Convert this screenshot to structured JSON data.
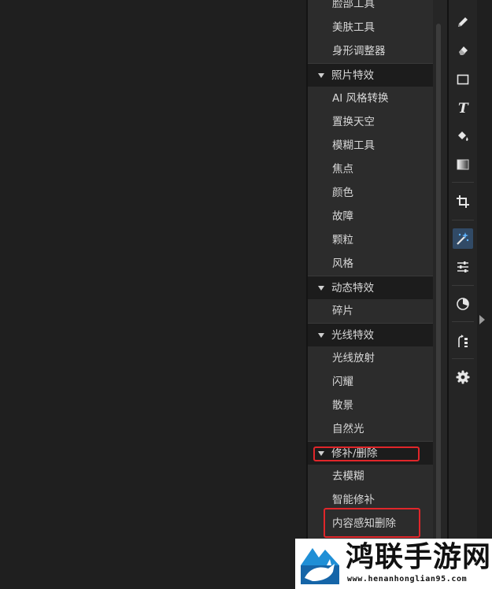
{
  "panel": {
    "rows": [
      {
        "type": "item",
        "label": "脸部工具"
      },
      {
        "type": "item",
        "label": "美肤工具"
      },
      {
        "type": "item",
        "label": "身形调整器"
      },
      {
        "type": "header",
        "label": "照片特效"
      },
      {
        "type": "item",
        "label": "AI 风格转换"
      },
      {
        "type": "item",
        "label": "置换天空"
      },
      {
        "type": "item",
        "label": "模糊工具"
      },
      {
        "type": "item",
        "label": "焦点"
      },
      {
        "type": "item",
        "label": "颜色"
      },
      {
        "type": "item",
        "label": "故障"
      },
      {
        "type": "item",
        "label": "颗粒"
      },
      {
        "type": "item",
        "label": "风格"
      },
      {
        "type": "header",
        "label": "动态特效"
      },
      {
        "type": "item",
        "label": "碎片"
      },
      {
        "type": "header",
        "label": "光线特效"
      },
      {
        "type": "item",
        "label": "光线放射"
      },
      {
        "type": "item",
        "label": "闪耀"
      },
      {
        "type": "item",
        "label": "散景"
      },
      {
        "type": "item",
        "label": "自然光"
      },
      {
        "type": "header",
        "label": "修补/删除"
      },
      {
        "type": "item",
        "label": "去模糊"
      },
      {
        "type": "item",
        "label": "智能修补"
      },
      {
        "type": "item",
        "label": "内容感知删除"
      }
    ]
  },
  "toolbar": {
    "tools": [
      "brush-icon",
      "eraser-icon",
      "rectangle-icon",
      "text-icon",
      "fill-icon",
      "gradient-icon",
      "crop-icon",
      "magic-wand-icon",
      "adjust-sliders-icon",
      "mask-icon",
      "effects-icon",
      "settings-icon"
    ],
    "active_tool": "magic-wand-icon"
  },
  "watermark": {
    "title": "鸿联手游网",
    "url": "www.henanhonglian95.com"
  },
  "colors": {
    "highlight": "#e0262a",
    "active_tool_bg": "#314a66"
  }
}
